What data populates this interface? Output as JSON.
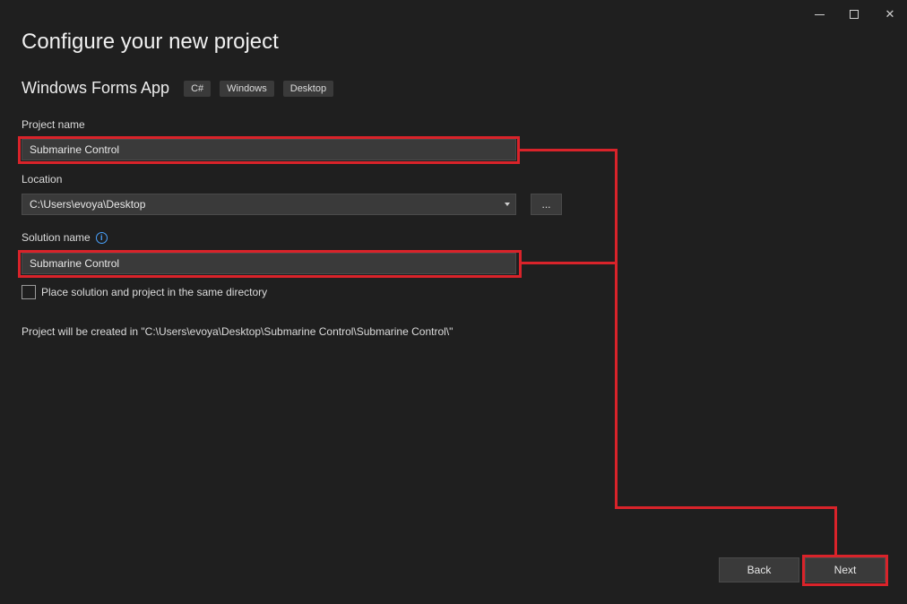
{
  "window": {
    "title": "Configure your new project"
  },
  "template": {
    "name": "Windows Forms App",
    "tags": [
      "C#",
      "Windows",
      "Desktop"
    ]
  },
  "form": {
    "project_name_label": "Project name",
    "project_name_value": "Submarine Control",
    "location_label": "Location",
    "location_value": "C:\\Users\\evoya\\Desktop",
    "browse_label": "...",
    "solution_name_label": "Solution name",
    "solution_name_value": "Submarine Control",
    "same_dir_label": "Place solution and project in the same directory",
    "created_in_text": "Project will be created in \"C:\\Users\\evoya\\Desktop\\Submarine Control\\Submarine Control\\\""
  },
  "buttons": {
    "back": "Back",
    "next": "Next"
  },
  "icons": {
    "minimize": "minimize-icon",
    "maximize": "maximize-icon",
    "close": "close-icon",
    "info": "info-icon",
    "dropdown": "chevron-down-icon"
  },
  "colors": {
    "background": "#1f1f1f",
    "field": "#3a3a3a",
    "highlight": "#d9232a",
    "info": "#4aa3ff"
  }
}
